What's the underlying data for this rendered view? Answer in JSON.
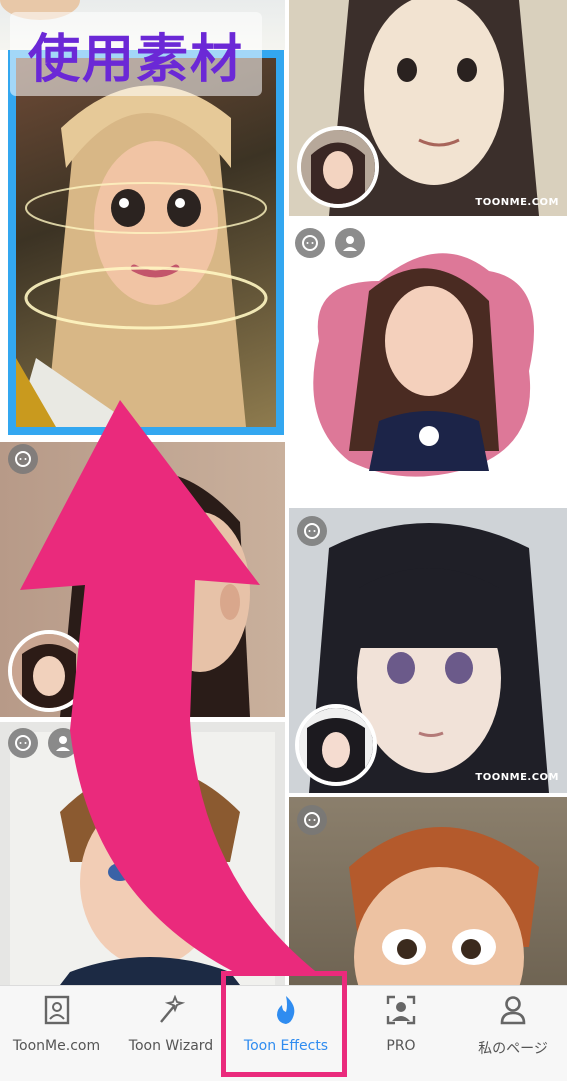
{
  "overlay": {
    "title": "使用素材",
    "accent_color": "#ea2a7c",
    "title_color": "#6b28d6",
    "selected_border_color": "#33a7f0"
  },
  "feed": {
    "watermark_text": "TOONME.COM",
    "tiles": [
      {
        "name": "selected-toon-blonde",
        "badges": []
      },
      {
        "name": "toon-anime-girl",
        "badges": [],
        "watermark": "TOONME.COM"
      },
      {
        "name": "toon-dark-hair",
        "badges": [
          "face-icon"
        ]
      },
      {
        "name": "toon-pink-splash",
        "badges": [
          "face-icon",
          "person-icon"
        ]
      },
      {
        "name": "toon-anime-bangs",
        "badges": [
          "face-icon"
        ],
        "watermark": "TOONME.COM"
      },
      {
        "name": "toon-boy-sketch",
        "badges": [
          "face-icon",
          "person-icon"
        ]
      },
      {
        "name": "toon-3d-short-hair",
        "badges": [
          "face-icon"
        ]
      }
    ]
  },
  "tabbar": {
    "active_color": "#2f8cf0",
    "tabs": [
      {
        "label": "ToonMe.com",
        "icon": "portrait-frame-icon"
      },
      {
        "label": "Toon Wizard",
        "icon": "magic-wand-icon"
      },
      {
        "label": "Toon Effects",
        "icon": "flame-icon",
        "active": true
      },
      {
        "label": "PRO",
        "icon": "face-scan-icon"
      },
      {
        "label": "私のページ",
        "icon": "user-icon"
      }
    ]
  }
}
